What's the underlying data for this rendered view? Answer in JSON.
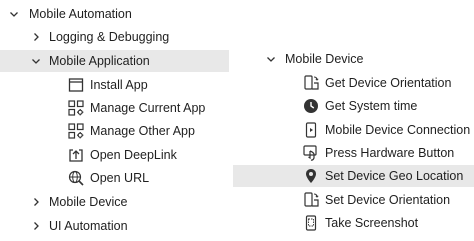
{
  "left_tree": {
    "root": {
      "label": "Mobile Automation",
      "expanded": true
    },
    "items": [
      {
        "label": "Logging & Debugging",
        "expanded": false
      },
      {
        "label": "Mobile Application",
        "expanded": true,
        "selected": true
      },
      {
        "label": "Mobile Device",
        "expanded": false
      },
      {
        "label": "UI Automation",
        "expanded": false
      }
    ],
    "mobile_application_children": [
      {
        "label": "Install App",
        "icon": "window-icon"
      },
      {
        "label": "Manage Current App",
        "icon": "grid-settings-icon"
      },
      {
        "label": "Manage Other App",
        "icon": "grid-settings-icon"
      },
      {
        "label": "Open DeepLink",
        "icon": "open-link-icon"
      },
      {
        "label": "Open URL",
        "icon": "globe-search-icon"
      }
    ]
  },
  "right_tree": {
    "root": {
      "label": "Mobile Device",
      "expanded": true
    },
    "items": [
      {
        "label": "Get Device Orientation",
        "icon": "device-rotate-icon"
      },
      {
        "label": "Get System time",
        "icon": "clock-icon"
      },
      {
        "label": "Mobile Device Connection",
        "icon": "device-icon"
      },
      {
        "label": "Press Hardware Button",
        "icon": "device-press-icon"
      },
      {
        "label": "Set Device Geo Location",
        "icon": "location-pin-icon",
        "selected": true
      },
      {
        "label": "Set Device Orientation",
        "icon": "device-rotate-icon"
      },
      {
        "label": "Take Screenshot",
        "icon": "screenshot-icon"
      }
    ]
  },
  "colors": {
    "text": "#1f1f1f",
    "icon": "#333333",
    "selection_bg": "#e8e8e8"
  }
}
